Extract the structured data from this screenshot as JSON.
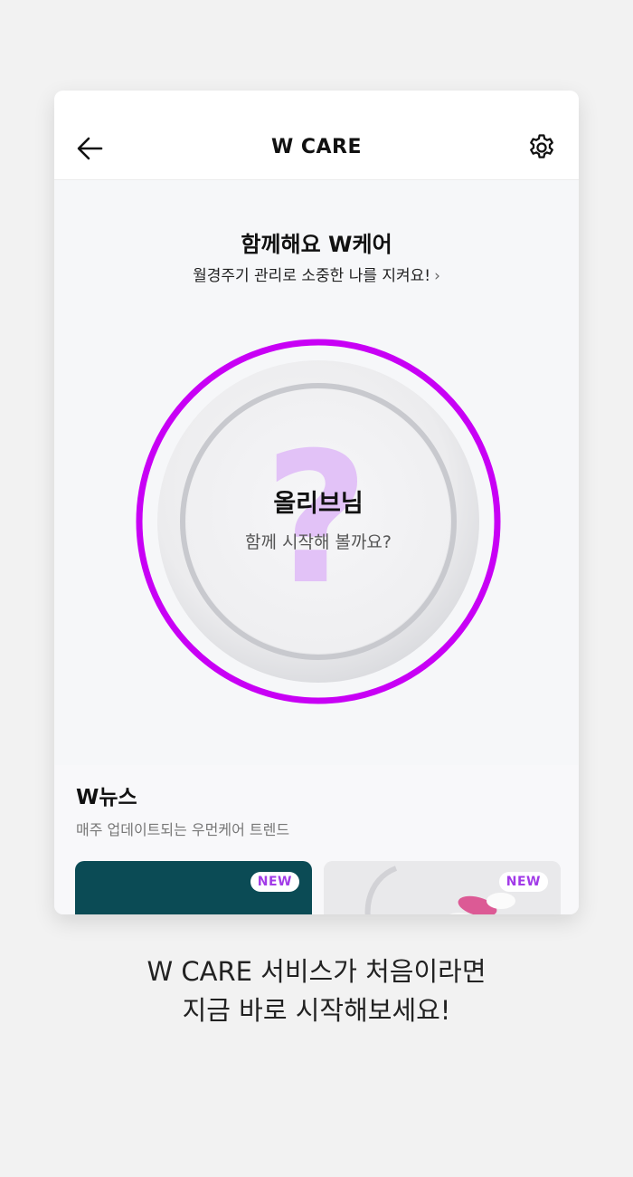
{
  "header": {
    "title": "W CARE",
    "back_icon": "arrow-left-icon",
    "settings_icon": "gear-icon"
  },
  "intro": {
    "title": "함께해요 W케어",
    "subtitle": "월경주기 관리로 소중한 나를 지켜요!",
    "chevron": "›"
  },
  "dial": {
    "name": "올리브님",
    "message": "함께 시작해 볼까요?",
    "ring_color": "#c800f5",
    "question_mark": "?",
    "question_color": "#e2c2f7"
  },
  "news": {
    "title": "W뉴스",
    "subtitle": "매주 업데이트되는 우먼케어 트렌드",
    "cards": [
      {
        "badge": "NEW"
      },
      {
        "badge": "NEW"
      }
    ]
  },
  "footer": {
    "line1": "W CARE 서비스가 처음이라면",
    "line2": "지금 바로 시작해보세요!"
  }
}
